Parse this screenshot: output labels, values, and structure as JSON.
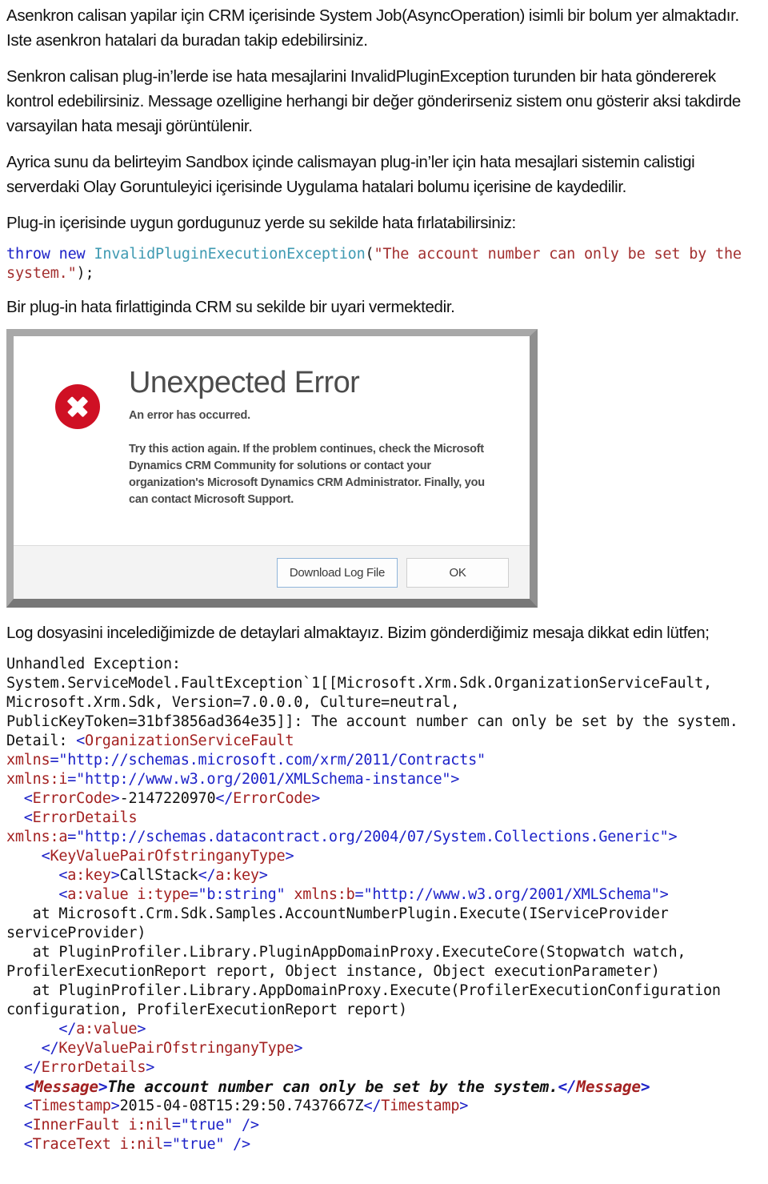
{
  "paragraphs": {
    "p1": "Asenkron calisan yapilar için CRM içerisinde System Job(AsyncOperation) isimli bir bolum yer almaktadır. Iste asenkron hatalari da buradan takip edebilirsiniz.",
    "p2": "Senkron calisan plug-in’lerde ise hata mesajlarini InvalidPluginException turunden bir hata göndererek kontrol edebilirsiniz. Message ozelligine herhangi bir değer gönderirseniz sistem onu gösterir aksi takdirde varsayilan hata mesaji görüntülenir.",
    "p3": "Ayrica sunu da belirteyim Sandbox içinde calismayan plug-in’ler için hata mesajlari sistemin calistigi serverdaki Olay Goruntuleyici içerisinde Uygulama hatalari bolumu içerisine de kaydedilir.",
    "p4": "Plug-in içerisinde uygun gordugunuz yerde su sekilde hata fırlatabilirsiniz:",
    "p5": "Bir plug-in hata firlattiginda CRM su sekilde bir uyari vermektedir.",
    "p6": "Log dosyasini incelediğimizde de detaylari almaktayız. Bizim gönderdiğimiz mesaja dikkat edin lütfen;"
  },
  "code_snippet": {
    "keyword_throw": "throw",
    "keyword_new": "new",
    "type_name": "InvalidPluginExecutionException",
    "open_paren": "(",
    "string_literal": "\"The account number can only be set by the system.\"",
    "close": ");"
  },
  "error_dialog": {
    "title": "Unexpected Error",
    "subtitle": "An error has occurred.",
    "body": "Try this action again. If the problem continues, check the Microsoft Dynamics CRM Community for solutions or contact your organization's Microsoft Dynamics CRM Administrator. Finally, you can contact Microsoft Support.",
    "download_button": "Download Log File",
    "ok_button": "OK",
    "icon": "error-x-icon",
    "accent_color": "#cf1024"
  },
  "log_dump": {
    "line_01": "Unhandled Exception:",
    "line_02": "System.ServiceModel.FaultException`1[[Microsoft.Xrm.Sdk.OrganizationServiceFault,",
    "line_03": "Microsoft.Xrm.Sdk, Version=7.0.0.0, Culture=neutral,",
    "line_04": "PublicKeyToken=31bf3856ad364e35]]: The account number can only be set by the system.",
    "detail_label": "Detail: ",
    "tag_orgservicefault": "OrganizationServiceFault",
    "attr_xmlns": "xmlns",
    "val_xmlns": "\"http://schemas.microsoft.com/xrm/2011/Contracts\"",
    "attr_xmlns_i": "xmlns:i",
    "val_xmlns_i": "\"http://www.w3.org/2001/XMLSchema-instance\"",
    "tag_errorcode": "ErrorCode",
    "val_errorcode": "-2147220970",
    "tag_errordetails": "ErrorDetails",
    "attr_xmlns_a": "xmlns:a",
    "val_xmlns_a": "\"http://schemas.datacontract.org/2004/07/System.Collections.Generic\"",
    "tag_kvp": "KeyValuePairOfstringanyType",
    "tag_akey": "a:key",
    "val_akey": "CallStack",
    "tag_avalue": "a:value",
    "attr_itype": "i:type",
    "val_itype": "\"b:string\"",
    "attr_xmlns_b": "xmlns:b",
    "val_xmlns_b": "\"http://www.w3.org/2001/XMLSchema\"",
    "stack_01": "   at Microsoft.Crm.Sdk.Samples.AccountNumberPlugin.Execute(IServiceProvider serviceProvider)",
    "stack_02": "   at PluginProfiler.Library.PluginAppDomainProxy.ExecuteCore(Stopwatch watch, ProfilerExecutionReport report, Object instance, Object executionParameter)",
    "stack_03": "   at PluginProfiler.Library.AppDomainProxy.Execute(ProfilerExecutionConfiguration configuration, ProfilerExecutionReport report)",
    "tag_message": "Message",
    "val_message": "The account number can only be set by the system.",
    "tag_timestamp": "Timestamp",
    "val_timestamp": "2015-04-08T15:29:50.7437667Z",
    "tag_innerfault": "InnerFault",
    "attr_inil": "i:nil",
    "val_inil": "\"true\"",
    "tag_tracetext": "TraceText"
  }
}
